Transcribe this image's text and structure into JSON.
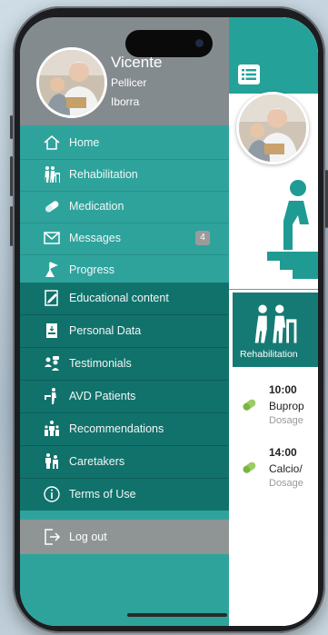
{
  "user": {
    "first_name": "Vicente",
    "last_name_1": "Pellicer",
    "last_name_2": "Iborra"
  },
  "drawer": {
    "primary_items": [
      {
        "label": "Home",
        "icon": "home-icon"
      },
      {
        "label": "Rehabilitation",
        "icon": "rehabilitation-icon"
      },
      {
        "label": "Medication",
        "icon": "pill-icon"
      },
      {
        "label": "Messages",
        "icon": "envelope-icon",
        "badge": "4"
      },
      {
        "label": "Progress",
        "icon": "progress-flag-icon"
      }
    ],
    "secondary_items": [
      {
        "label": "Educational content",
        "icon": "edit-document-icon"
      },
      {
        "label": "Personal Data",
        "icon": "personal-data-icon"
      },
      {
        "label": "Testimonials",
        "icon": "testimonials-icon"
      },
      {
        "label": "AVD Patients",
        "icon": "avd-patients-icon"
      },
      {
        "label": "Recommendations",
        "icon": "recommendations-icon"
      },
      {
        "label": "Caretakers",
        "icon": "caretakers-icon"
      },
      {
        "label": "Terms of Use",
        "icon": "info-icon"
      }
    ],
    "logout_label": "Log out"
  },
  "main": {
    "tile_label": "Rehabilitation",
    "medications": [
      {
        "time": "10:00",
        "name": "Buprop",
        "dose": "Dosage"
      },
      {
        "time": "14:00",
        "name": "Calcio/",
        "dose": "Dosage"
      }
    ]
  },
  "colors": {
    "teal": "#2ea39c",
    "dark_teal": "#11726c",
    "grey": "#848b8e",
    "tile": "#167a74"
  }
}
